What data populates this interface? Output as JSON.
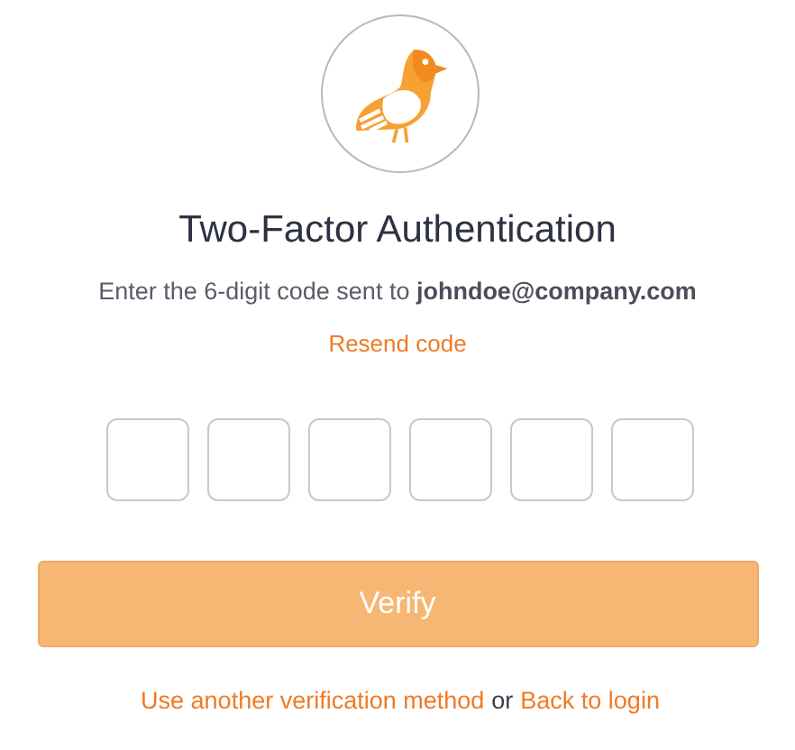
{
  "logo": {
    "kind": "bird"
  },
  "title": "Two-Factor Authentication",
  "instruction": "Enter the 6-digit code sent to **johndoe@company.com**",
  "resend_link": "Resend code",
  "code_fields": [
    {
      "kind": "digit"
    },
    {
      "kind": "digit"
    },
    {
      "kind": "digit"
    },
    {
      "kind": "digit"
    },
    {
      "kind": "digit"
    },
    {
      "kind": "digit"
    }
  ],
  "verify_button": {
    "label": "Verify",
    "disabled": true
  },
  "footer": {
    "alternate_link": "Use another verification method",
    "separator": "or",
    "back_link": "Back to login"
  }
}
